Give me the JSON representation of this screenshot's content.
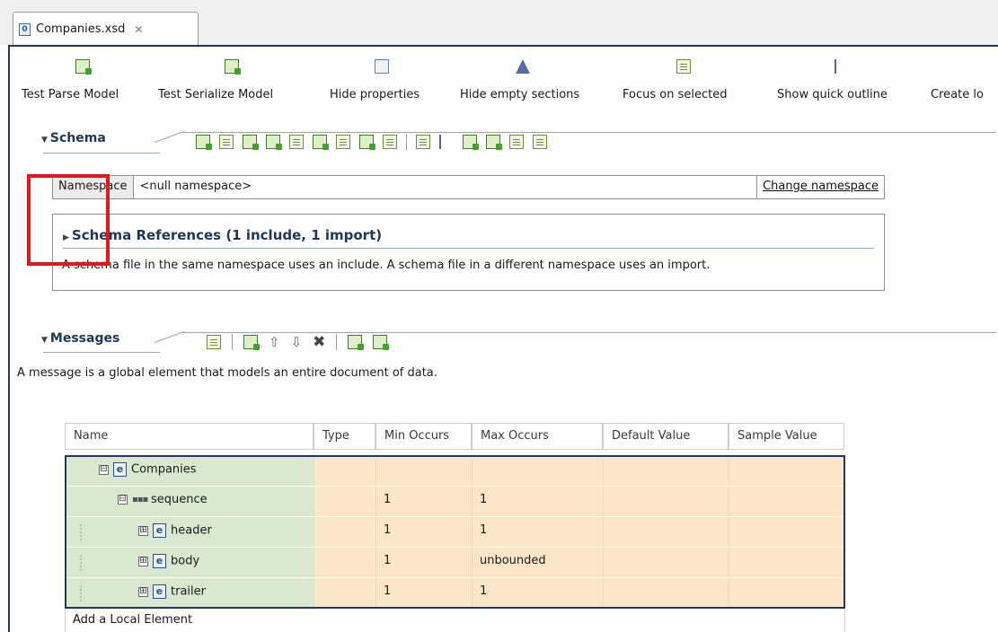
{
  "tab": {
    "title": "Companies.xsd",
    "close_glyph": "✕"
  },
  "toolbar": {
    "items": [
      {
        "label": "Test Parse Model",
        "icon": "test-parse-icon"
      },
      {
        "label": "Test Serialize Model",
        "icon": "test-serialize-icon"
      },
      {
        "label": "Hide properties",
        "icon": "properties-icon"
      },
      {
        "label": "Hide empty sections",
        "icon": "empty-sections-icon"
      },
      {
        "label": "Focus on selected",
        "icon": "focus-icon"
      },
      {
        "label": "Show quick outline",
        "icon": "outline-icon"
      },
      {
        "label": "Create lo",
        "icon": "create-icon"
      }
    ]
  },
  "schema_section": {
    "title": "Schema",
    "namespace_label": "Namespace",
    "namespace_value": "<null namespace>",
    "change_namespace": "Change namespace",
    "references_title": "Schema References  (1 include, 1 import)",
    "references_description": "A schema file in the same namespace uses an include. A schema file in a different namespace uses an import."
  },
  "messages_section": {
    "title": "Messages",
    "description": "A message is a global element that models an entire document of data."
  },
  "table": {
    "headers": [
      "Name",
      "Type",
      "Min Occurs",
      "Max Occurs",
      "Default Value",
      "Sample Value"
    ],
    "rows": [
      {
        "name": "Companies",
        "kind": "element",
        "min": "",
        "max": "",
        "expander": "⊟"
      },
      {
        "name": "sequence",
        "kind": "sequence",
        "min": "1",
        "max": "1",
        "expander": "⊟",
        "glyph": "▪▪▪"
      },
      {
        "name": "header",
        "kind": "element",
        "min": "1",
        "max": "1",
        "expander": "⊞"
      },
      {
        "name": "body",
        "kind": "element",
        "min": "1",
        "max": "unbounded",
        "expander": "⊞"
      },
      {
        "name": "trailer",
        "kind": "element",
        "min": "1",
        "max": "1",
        "expander": "⊞"
      }
    ],
    "add_local": "Add a Local Element",
    "element_badge": "e"
  },
  "colors": {
    "highlight_box": "#e3161b",
    "name_column_bg": "#d9e8cf",
    "value_column_bg": "#fce6c9",
    "table_border": "#22385a"
  }
}
